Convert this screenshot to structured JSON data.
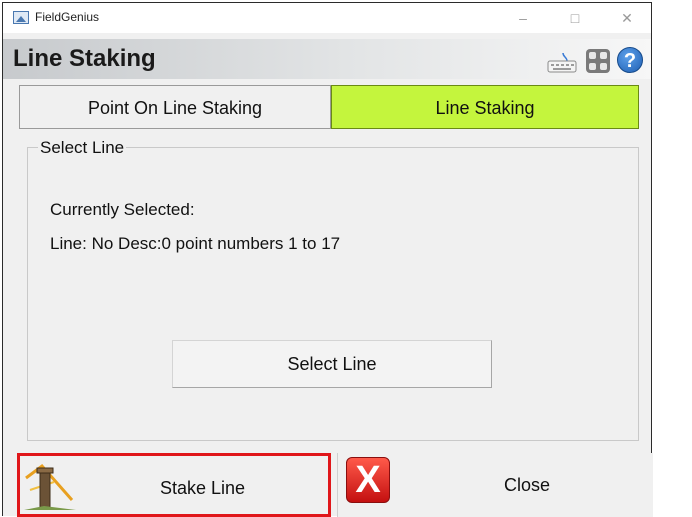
{
  "window": {
    "app_title": "FieldGenius",
    "controls": {
      "minimize": "–",
      "maximize": "□",
      "close": "✕"
    }
  },
  "header": {
    "title": "Line Staking",
    "icons": [
      "keyboard-icon",
      "calculator-icon",
      "help-icon"
    ],
    "help_glyph": "?"
  },
  "tabs": [
    {
      "label": "Point On Line Staking",
      "active": false
    },
    {
      "label": "Line Staking",
      "active": true
    }
  ],
  "accent_color": "#c4f53d",
  "highlight_color": "#e0161a",
  "select_group": {
    "title": "Select Line",
    "currently_selected_label": "Currently Selected:",
    "current_line": "Line: No Desc:0 point numbers 1 to 17",
    "select_button": "Select Line"
  },
  "actions": {
    "stake_label": "Stake Line",
    "close_label": "Close",
    "close_glyph": "X"
  }
}
